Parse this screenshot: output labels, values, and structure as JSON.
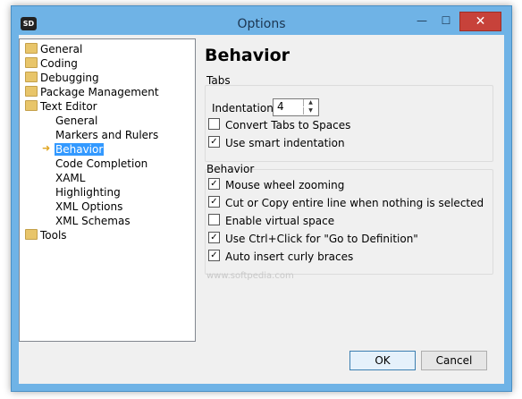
{
  "window": {
    "title": "Options",
    "icon_text": "SD",
    "minimize": "—",
    "maximize": "☐",
    "close": "✕"
  },
  "tree": {
    "general": "General",
    "coding": "Coding",
    "debugging": "Debugging",
    "package_management": "Package Management",
    "text_editor": "Text Editor",
    "te_general": "General",
    "markers": "Markers and Rulers",
    "behavior": "Behavior",
    "code_completion": "Code Completion",
    "xaml": "XAML",
    "highlighting": "Highlighting",
    "xaml_options": "XML Options",
    "xml_schemas": "XML Schemas",
    "tools": "Tools"
  },
  "page": {
    "heading": "Behavior"
  },
  "tabs_group": {
    "label": "Tabs",
    "indentation_label": "Indentation",
    "indentation_value": "4",
    "convert_tabs": {
      "label": "Convert Tabs to Spaces",
      "checked": false
    },
    "smart_indent": {
      "label": "Use smart indentation",
      "checked": true
    }
  },
  "behavior_group": {
    "label": "Behavior",
    "mouse_wheel": {
      "label": "Mouse wheel zooming",
      "checked": true
    },
    "cut_copy_line": {
      "label": "Cut or Copy entire line when nothing is selected",
      "checked": true
    },
    "virtual_space": {
      "label": "Enable virtual space",
      "checked": false
    },
    "ctrl_click": {
      "label": "Use Ctrl+Click for \"Go to Definition\"",
      "checked": true
    },
    "curly_braces": {
      "label": "Auto insert curly braces",
      "checked": true
    }
  },
  "buttons": {
    "ok": "OK",
    "cancel": "Cancel"
  },
  "watermark": "www.softpedia.com"
}
